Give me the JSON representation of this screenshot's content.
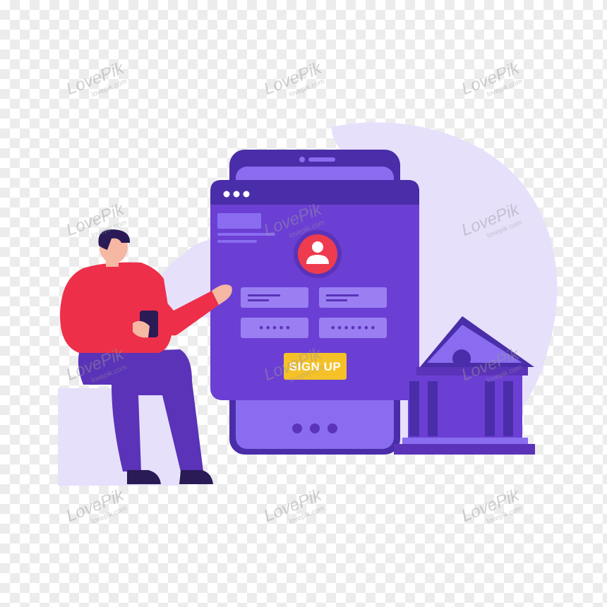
{
  "form": {
    "password_mask_left": "•••••",
    "password_mask_right": "•••••••",
    "signup_label": "SIGN UP"
  },
  "watermark": {
    "brand": "LovePik",
    "site": "lovepik.com"
  },
  "colors": {
    "phone_purple": "#6b3fd4",
    "phone_dark": "#4a2da8",
    "phone_light": "#8a6cf0",
    "button_yellow": "#f5c128",
    "avatar_red": "#ef3b4f",
    "shirt_red": "#ee2f4a",
    "pants_purple": "#5a33b8",
    "blob_lavender": "#e6e0fb"
  },
  "icons": {
    "avatar": "user-icon",
    "bank": "bank-icon",
    "person": "person-illustration"
  }
}
